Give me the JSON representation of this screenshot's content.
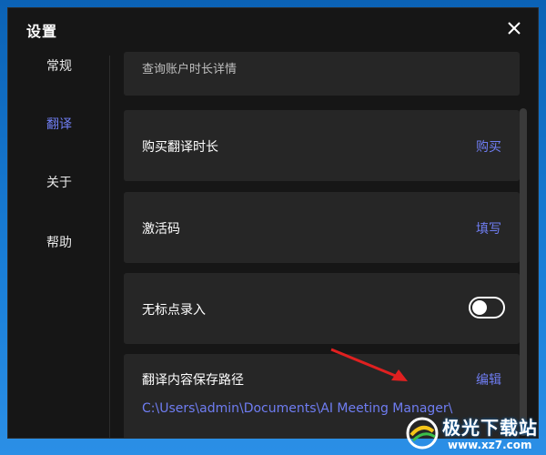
{
  "window": {
    "title": "设置"
  },
  "sidebar": {
    "items": [
      {
        "label": "常规",
        "active": false
      },
      {
        "label": "翻译",
        "active": true
      },
      {
        "label": "关于",
        "active": false
      },
      {
        "label": "帮助",
        "active": false
      }
    ]
  },
  "settings": {
    "account_detail_label": "查询账户时长详情",
    "buy_time": {
      "label": "购买翻译时长",
      "action": "购买"
    },
    "activation_code": {
      "label": "激活码",
      "action": "填写"
    },
    "no_punctuation": {
      "label": "无标点录入",
      "enabled": false
    },
    "save_path": {
      "label": "翻译内容保存路径",
      "action": "编辑",
      "path": "C:\\Users\\admin\\Documents\\AI Meeting Manager\\"
    }
  },
  "watermark": {
    "brand": "极光下载站",
    "url": "www.xz7.com"
  },
  "colors": {
    "accent": "#6f7df2",
    "background": "#161616",
    "card": "#262626",
    "annotation_arrow": "#e02020"
  },
  "icons": {
    "close": "close-icon",
    "arrow": "red-annotation-arrow"
  }
}
